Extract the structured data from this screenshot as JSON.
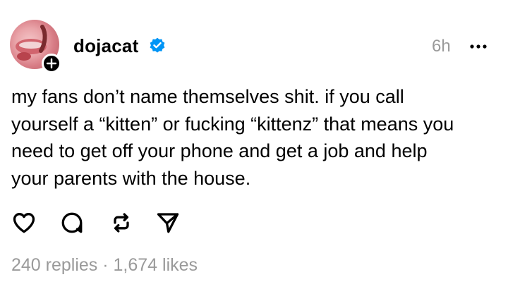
{
  "post": {
    "author": {
      "username": "dojacat",
      "verified": true,
      "avatar": "avatar-photo",
      "follow_badge": "plus-icon"
    },
    "timestamp": "6h",
    "more_icon": "more-horizontal-icon",
    "text": "my fans don’t name themselves shit. if you call\nyourself a “kitten” or fucking “kittenz” that means you\nneed to get off your phone and get a job and help\nyour parents with the house.",
    "actions": [
      {
        "name": "like",
        "icon": "heart-icon"
      },
      {
        "name": "reply",
        "icon": "comment-icon"
      },
      {
        "name": "repost",
        "icon": "repost-icon"
      },
      {
        "name": "share",
        "icon": "send-icon"
      }
    ],
    "stats": "240 replies · 1,674 likes"
  },
  "colors": {
    "text": "#000000",
    "muted": "#9a9a9a",
    "verified": "#0095f6",
    "background": "#ffffff"
  }
}
